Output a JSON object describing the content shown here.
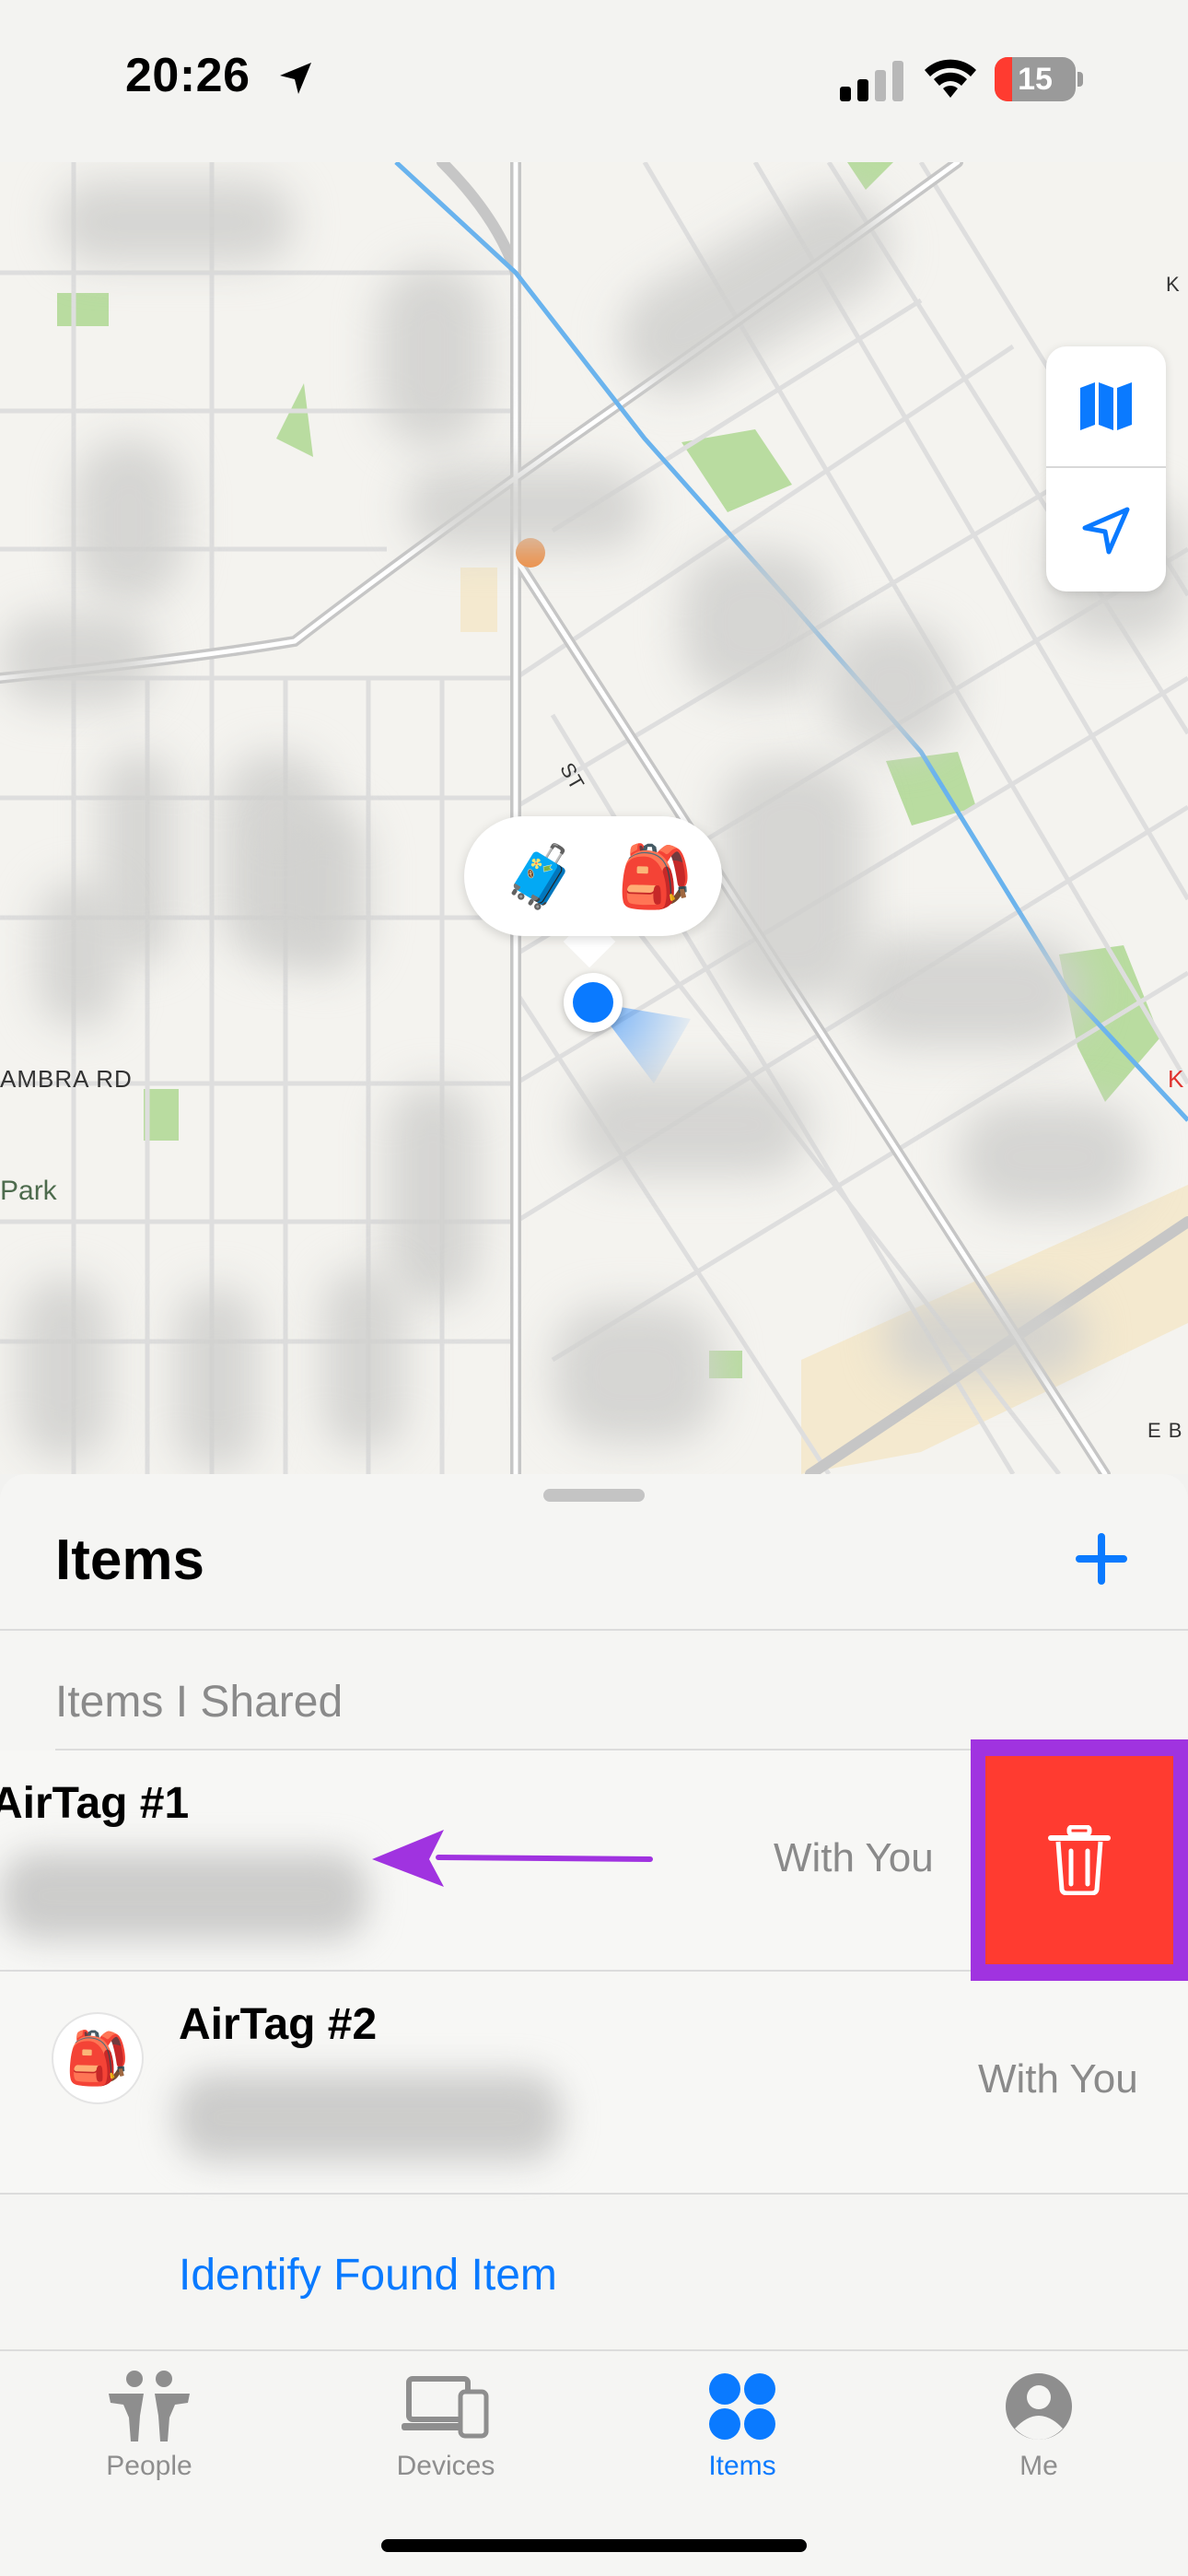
{
  "status_bar": {
    "time": "20:26",
    "battery_level": "15",
    "battery_fraction": 0.15,
    "icons": [
      "location-arrow-icon",
      "cellular-signal-icon",
      "wifi-icon",
      "battery-charging-icon"
    ]
  },
  "map": {
    "street_label": "AMBRA RD",
    "park_label": "Park",
    "tile_labels": [
      "ST",
      "K",
      "E B",
      "K"
    ],
    "controls": [
      "map-mode-icon",
      "locate-me-icon"
    ],
    "bubble_items": [
      "🧳",
      "🎒"
    ]
  },
  "sheet": {
    "title": "Items",
    "add_icon": "plus-icon",
    "section_header": "Items I Shared",
    "items": [
      {
        "name": "AirTag #1",
        "status": "With You",
        "icon": "🎒"
      },
      {
        "name": "AirTag #2",
        "status": "With You",
        "icon": "🎒"
      }
    ],
    "identify_link": "Identify Found Item",
    "delete_icon": "trash-icon"
  },
  "tab_bar": {
    "tabs": [
      {
        "label": "People",
        "icon": "people-icon",
        "active": false
      },
      {
        "label": "Devices",
        "icon": "devices-icon",
        "active": false
      },
      {
        "label": "Items",
        "icon": "items-icon",
        "active": true
      },
      {
        "label": "Me",
        "icon": "me-icon",
        "active": false
      }
    ]
  },
  "colors": {
    "accent": "#0a7aff",
    "delete": "#ff3b30",
    "annotation": "#a033e0",
    "battery_low": "#ff3b30"
  }
}
